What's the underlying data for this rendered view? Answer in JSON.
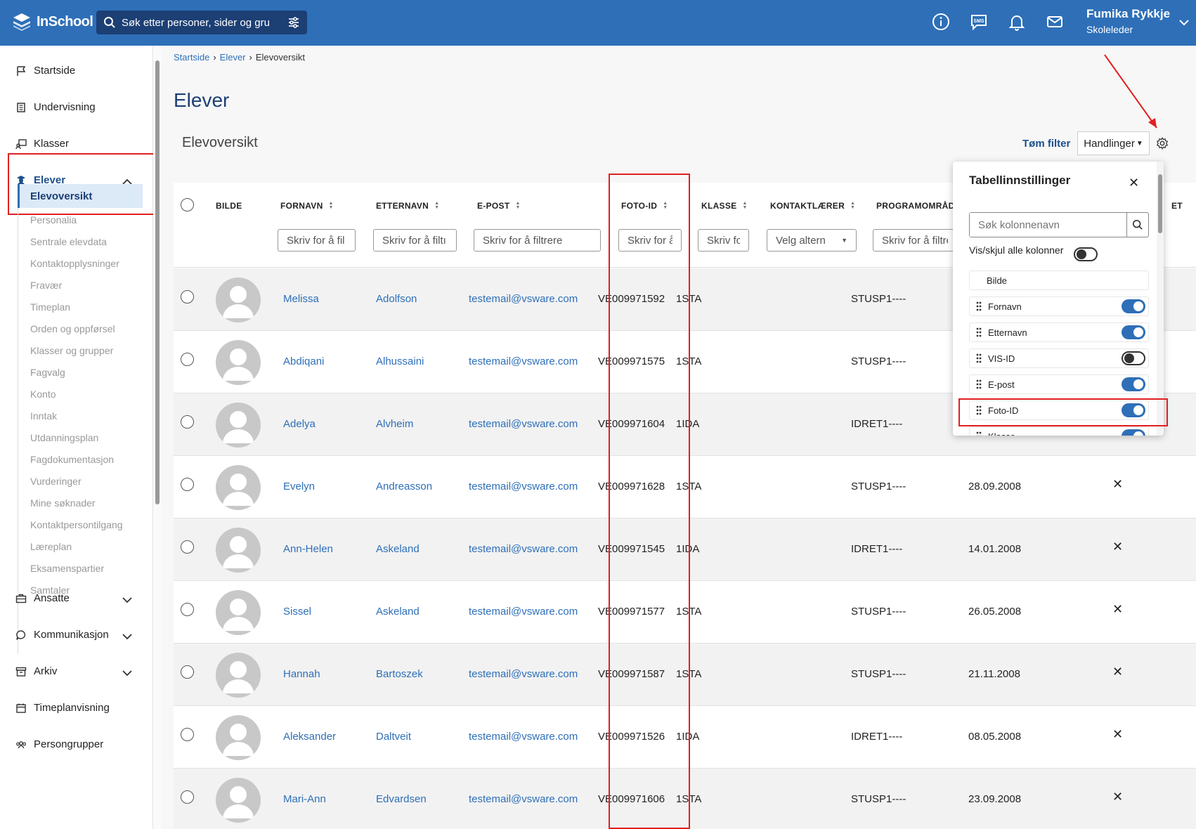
{
  "header": {
    "logo": "InSchool",
    "search_placeholder": "Søk etter personer, sider og gru",
    "user_name": "Fumika Rykkje",
    "user_role": "Skoleleder",
    "icons": [
      "info-icon",
      "sms-icon",
      "bell-icon",
      "mail-icon"
    ],
    "sms_label": "SMS"
  },
  "sidebar": {
    "items": [
      {
        "label": "Startside",
        "icon": "flag-icon"
      },
      {
        "label": "Undervisning",
        "icon": "book-icon"
      },
      {
        "label": "Klasser",
        "icon": "classroom-icon"
      },
      {
        "label": "Elever",
        "icon": "student-icon"
      }
    ],
    "elever_sub": [
      "Elevoversikt",
      "Personalia",
      "Sentrale elevdata",
      "Kontaktopplysninger",
      "Fravær",
      "Timeplan",
      "Orden og oppførsel",
      "Klasser og grupper",
      "Fagvalg",
      "Konto",
      "Inntak",
      "Utdanningsplan",
      "Fagdokumentasjon",
      "Vurderinger",
      "Mine søknader",
      "Kontaktpersontilgang",
      "Læreplan",
      "Eksamenspartier",
      "Samtaler"
    ],
    "bottom_items": [
      {
        "label": "Ansatte",
        "icon": "briefcase-icon",
        "expandable": true
      },
      {
        "label": "Kommunikasjon",
        "icon": "chat-icon",
        "expandable": true
      },
      {
        "label": "Arkiv",
        "icon": "archive-icon",
        "expandable": true
      },
      {
        "label": "Timeplanvisning",
        "icon": "calendar-icon",
        "expandable": false
      },
      {
        "label": "Persongrupper",
        "icon": "group-icon",
        "expandable": false
      }
    ]
  },
  "breadcrumb": {
    "items": [
      "Startside",
      "Elever"
    ],
    "current": "Elevoversikt"
  },
  "page_title": "Elever",
  "section_title": "Elevoversikt",
  "toolbar": {
    "clear_filter": "Tøm filter",
    "actions": "Handlinger"
  },
  "table": {
    "columns": {
      "bilde": "BILDE",
      "fornavn": "FORNAVN",
      "etternavn": "ETTERNAVN",
      "epost": "E-POST",
      "fotoid": "FOTO-ID",
      "klasse": "KLASSE",
      "kontaktlaerer": "KONTAKTLÆRER",
      "programomrade": "PROGRAMOMRÅDE",
      "et": "ET"
    },
    "filters": {
      "fornavn": "Skriv for å fil",
      "etternavn": "Skriv for å filtı",
      "epost": "Skriv for å filtrere",
      "fotoid": "Skriv for å",
      "klasse": "Skriv fc",
      "kontaktlaerer": "Velg altern",
      "programomrade": "Skriv for å filtre"
    },
    "rows": [
      {
        "fornavn": "Melissa",
        "etternavn": "Adolfson",
        "epost": "testemail@vsware.com",
        "fotoid": "VE009971592",
        "klasse": "1STA",
        "program": "STUSP1----",
        "dato": "",
        "x": ""
      },
      {
        "fornavn": "Abdiqani",
        "etternavn": "Alhussaini",
        "epost": "testemail@vsware.com",
        "fotoid": "VE009971575",
        "klasse": "1STA",
        "program": "STUSP1----",
        "dato": "",
        "x": ""
      },
      {
        "fornavn": "Adelya",
        "etternavn": "Alvheim",
        "epost": "testemail@vsware.com",
        "fotoid": "VE009971604",
        "klasse": "1IDA",
        "program": "IDRET1----",
        "dato": "",
        "x": ""
      },
      {
        "fornavn": "Evelyn",
        "etternavn": "Andreasson",
        "epost": "testemail@vsware.com",
        "fotoid": "VE009971628",
        "klasse": "1STA",
        "program": "STUSP1----",
        "dato": "28.09.2008",
        "x": "✕"
      },
      {
        "fornavn": "Ann-Helen",
        "etternavn": "Askeland",
        "epost": "testemail@vsware.com",
        "fotoid": "VE009971545",
        "klasse": "1IDA",
        "program": "IDRET1----",
        "dato": "14.01.2008",
        "x": "✕"
      },
      {
        "fornavn": "Sissel",
        "etternavn": "Askeland",
        "epost": "testemail@vsware.com",
        "fotoid": "VE009971577",
        "klasse": "1STA",
        "program": "STUSP1----",
        "dato": "26.05.2008",
        "x": "✕"
      },
      {
        "fornavn": "Hannah",
        "etternavn": "Bartoszek",
        "epost": "testemail@vsware.com",
        "fotoid": "VE009971587",
        "klasse": "1STA",
        "program": "STUSP1----",
        "dato": "21.11.2008",
        "x": "✕"
      },
      {
        "fornavn": "Aleksander",
        "etternavn": "Daltveit",
        "epost": "testemail@vsware.com",
        "fotoid": "VE009971526",
        "klasse": "1IDA",
        "program": "IDRET1----",
        "dato": "08.05.2008",
        "x": "✕"
      },
      {
        "fornavn": "Mari-Ann",
        "etternavn": "Edvardsen",
        "epost": "testemail@vsware.com",
        "fotoid": "VE009971606",
        "klasse": "1STA",
        "program": "STUSP1----",
        "dato": "23.09.2008",
        "x": "✕"
      }
    ]
  },
  "settings_panel": {
    "title": "Tabellinnstillinger",
    "search_placeholder": "Søk kolonnenavn",
    "toggle_all_label": "Vis/skjul alle kolonner",
    "columns": [
      {
        "label": "Bilde",
        "on": null
      },
      {
        "label": "Fornavn",
        "on": true
      },
      {
        "label": "Etternavn",
        "on": true
      },
      {
        "label": "VIS-ID",
        "on": false
      },
      {
        "label": "E-post",
        "on": true
      },
      {
        "label": "Foto-ID",
        "on": true
      },
      {
        "label": "Klasse",
        "on": true
      }
    ]
  },
  "colors": {
    "brand": "#2e6fb8",
    "search_bg": "#1c3f74",
    "highlight": "#e02020",
    "link": "#2e6fb8"
  }
}
